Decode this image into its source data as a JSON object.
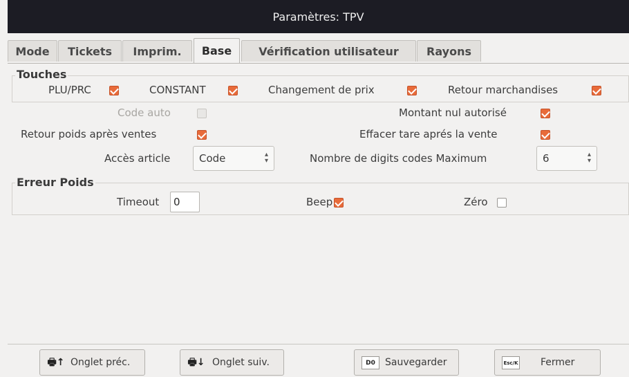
{
  "window": {
    "title": "Paramètres: TPV"
  },
  "tabs": [
    {
      "label": "Mode"
    },
    {
      "label": "Tickets"
    },
    {
      "label": "Imprim."
    },
    {
      "label": "Base"
    },
    {
      "label": "Vérification utilisateur"
    },
    {
      "label": "Rayons"
    }
  ],
  "touches": {
    "title": "Touches",
    "plu_prc": {
      "label": "PLU/PRC",
      "checked": true
    },
    "constant": {
      "label": "CONSTANT",
      "checked": true
    },
    "changement_prix": {
      "label": "Changement de prix",
      "checked": true
    },
    "retour_marchandises": {
      "label": "Retour marchandises",
      "checked": true
    }
  },
  "options": {
    "code_auto": {
      "label": "Code auto",
      "checked": false,
      "enabled": false
    },
    "montant_nul": {
      "label": "Montant nul autorisé",
      "checked": true
    },
    "retour_poids": {
      "label": "Retour poids après ventes",
      "checked": true
    },
    "effacer_tare": {
      "label": "Effacer tare aprés la vente",
      "checked": true
    },
    "acces_article": {
      "label": "Accès article",
      "value": "Code"
    },
    "nombre_digits": {
      "label": "Nombre de digits codes Maximum",
      "value": "6"
    }
  },
  "erreur_poids": {
    "title": "Erreur Poids",
    "timeout": {
      "label": "Timeout",
      "value": "0"
    },
    "beep": {
      "label": "Beep",
      "checked": true
    },
    "zero": {
      "label": "Zéro",
      "checked": false
    }
  },
  "footer": {
    "prev": {
      "label": "Onglet préc.",
      "icon": "printer-up-icon"
    },
    "next": {
      "label": "Onglet suiv.",
      "icon": "printer-down-icon"
    },
    "save": {
      "label": "Sauvegarder",
      "icon_text": "D0"
    },
    "close": {
      "label": "Fermer",
      "icon_text": "Esc/K"
    }
  },
  "colors": {
    "accent": "#e86b3a",
    "titlebar": "#1c1c24",
    "background": "#f2f1f0"
  }
}
